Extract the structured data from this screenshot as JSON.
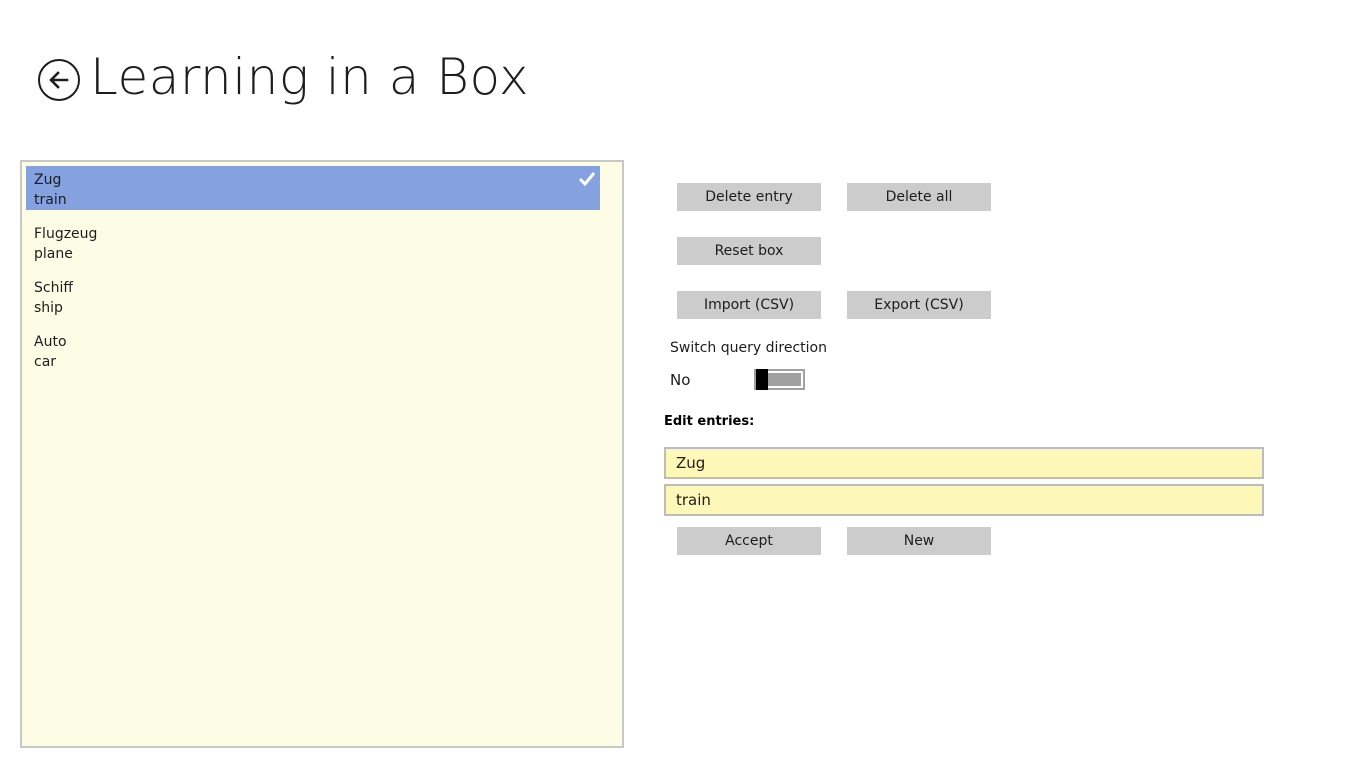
{
  "app": {
    "title": "Learning in a Box"
  },
  "entries": [
    {
      "word": "Zug",
      "translation": "train",
      "selected": true
    },
    {
      "word": "Flugzeug",
      "translation": "plane",
      "selected": false
    },
    {
      "word": "Schiff",
      "translation": "ship",
      "selected": false
    },
    {
      "word": "Auto",
      "translation": "car",
      "selected": false
    }
  ],
  "actions": {
    "delete_entry": "Delete entry",
    "delete_all": "Delete all",
    "reset_box": "Reset box",
    "import_csv": "Import (CSV)",
    "export_csv": "Export (CSV)",
    "accept": "Accept",
    "new": "New"
  },
  "query_direction": {
    "label": "Switch query direction",
    "state_text": "No",
    "on": false
  },
  "edit": {
    "label": "Edit entries:",
    "word_value": "Zug",
    "translation_value": "train"
  },
  "colors": {
    "selection": "#84a1e0",
    "list_background": "#fdfde5",
    "field_background": "#fdf8b8",
    "button": "#cccccc"
  },
  "icons": {
    "back": "back-arrow-icon",
    "check": "checkmark-icon"
  }
}
